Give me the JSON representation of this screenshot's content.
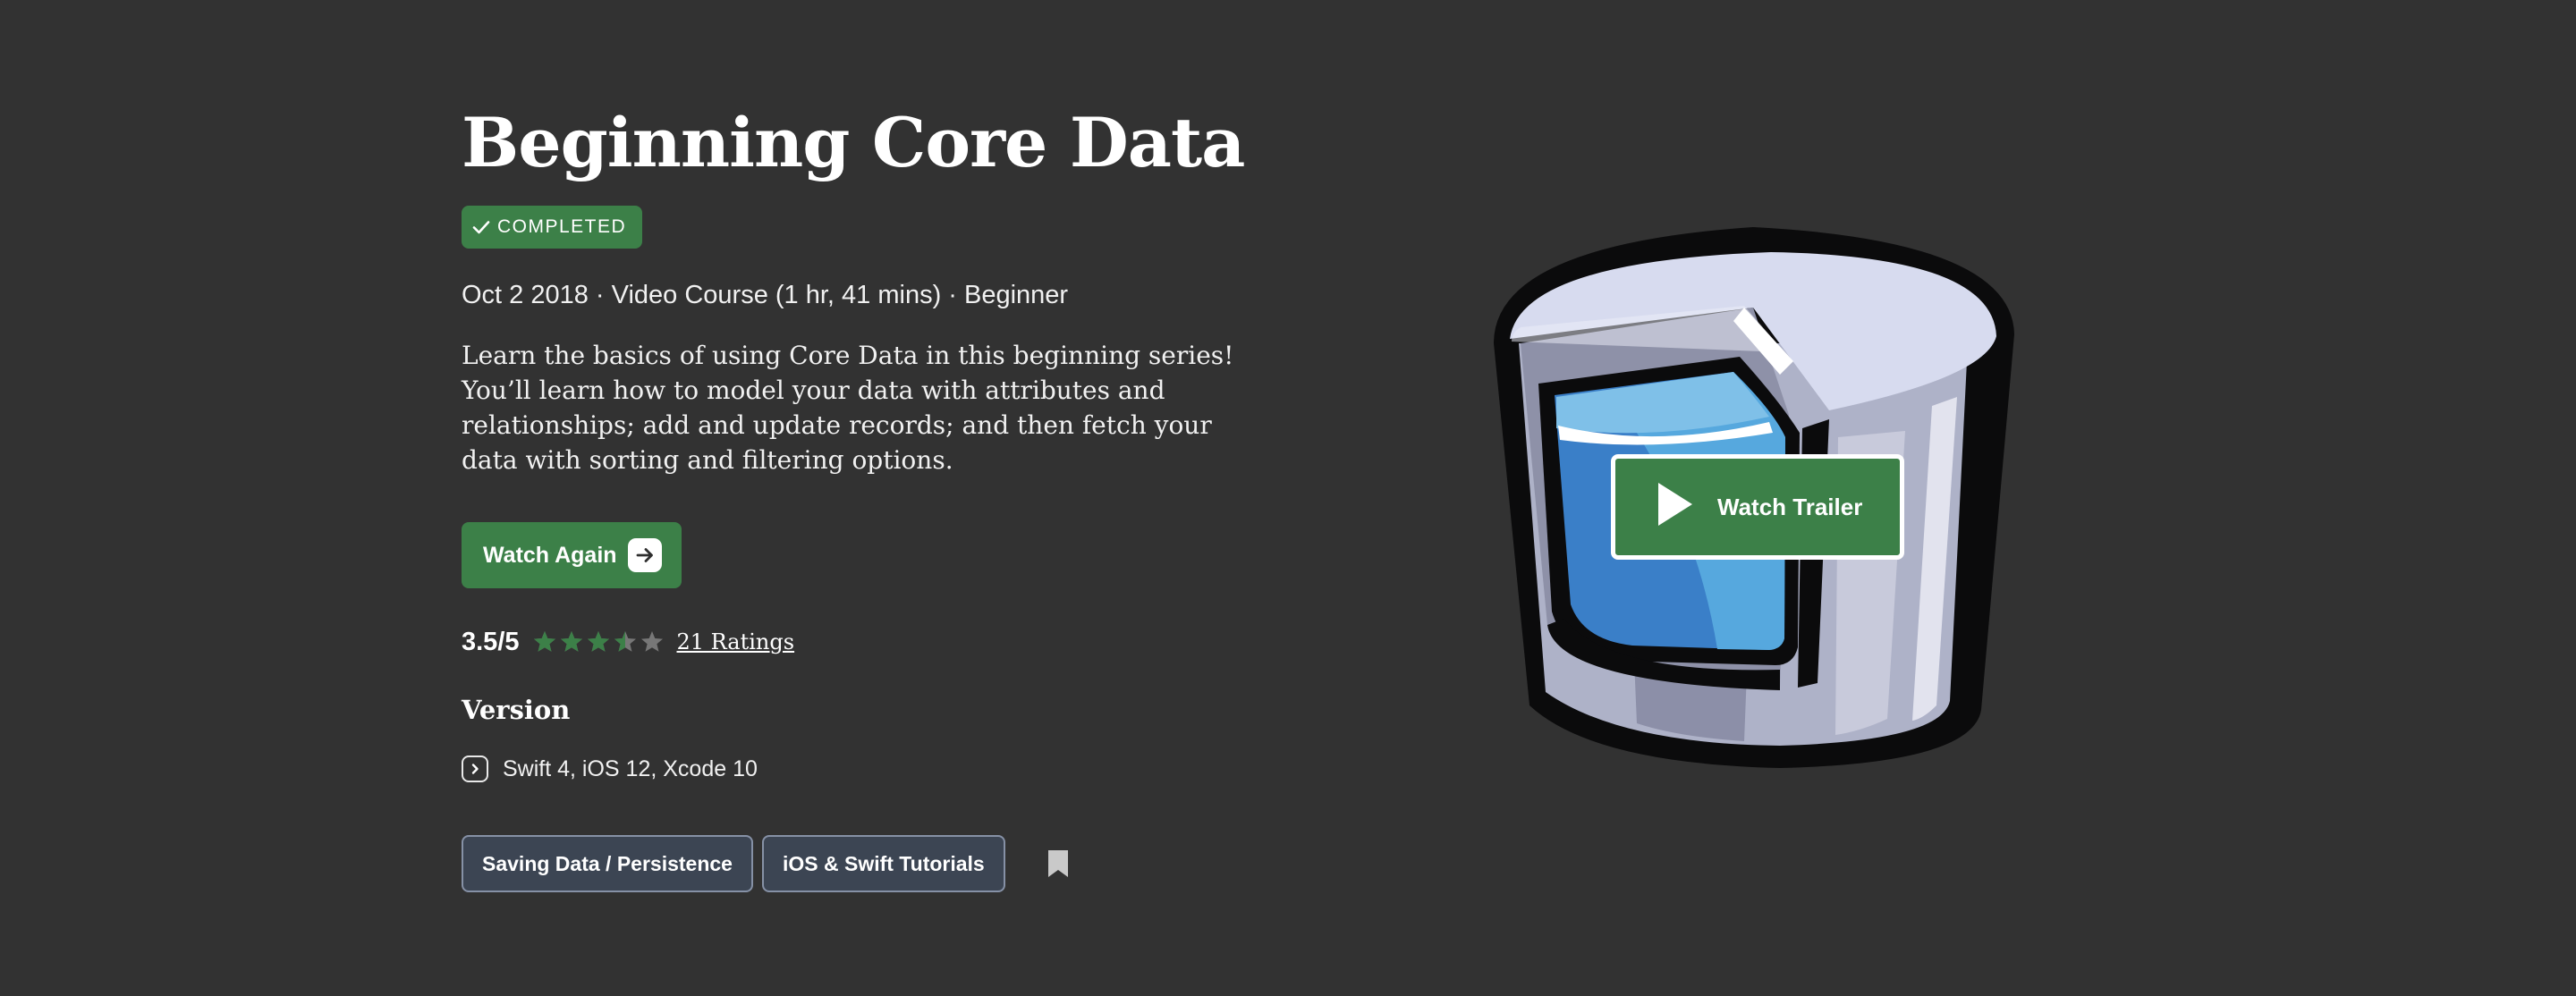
{
  "course": {
    "title": "Beginning Core Data",
    "status_badge": "COMPLETED",
    "meta": "Oct 2 2018 · Video Course (1 hr, 41 mins) · Beginner",
    "description": "Learn the basics of using Core Data in this beginning series! You’ll learn how to model your data with attributes and relationships; add and update records; and then fetch your data with sorting and filtering options.",
    "primary_action_label": "Watch Again"
  },
  "rating": {
    "value_text": "3.5/5",
    "stars_value": 3.5,
    "stars_max": 5,
    "ratings_link": "21 Ratings"
  },
  "version": {
    "heading": "Version",
    "value": "Swift 4, iOS 12, Xcode 10"
  },
  "tags": [
    {
      "label": "Saving Data / Persistence"
    },
    {
      "label": "iOS & Swift Tutorials"
    }
  ],
  "trailer": {
    "label": "Watch Trailer"
  },
  "colors": {
    "background": "#323232",
    "accent_green": "#3c8048",
    "tag_background": "#3c4553",
    "tag_border": "#8691a6",
    "star_empty": "#777777"
  },
  "icons": {
    "badge": "check-icon",
    "primary_action": "arrow-right-icon",
    "version": "chevron-right-icon",
    "bookmark": "bookmark-icon",
    "trailer": "play-icon",
    "artwork": "core-data-database-cylinder"
  }
}
